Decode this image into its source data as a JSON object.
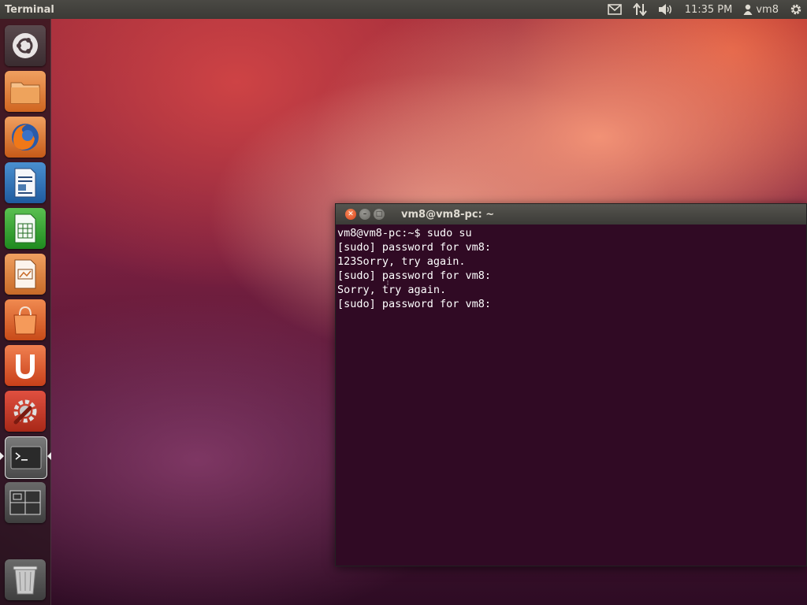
{
  "top_panel": {
    "app_title": "Terminal",
    "clock": "11:35 PM",
    "user": "vm8",
    "icons": [
      "mail-icon",
      "network-icon",
      "volume-icon",
      "user-icon",
      "gear-icon"
    ]
  },
  "launcher": {
    "items": [
      {
        "name": "dash-home",
        "icon": "ubuntu-logo-icon"
      },
      {
        "name": "home-folder",
        "icon": "folder-icon"
      },
      {
        "name": "firefox",
        "icon": "firefox-icon"
      },
      {
        "name": "libreoffice-writer",
        "icon": "writer-icon"
      },
      {
        "name": "libreoffice-calc",
        "icon": "calc-icon"
      },
      {
        "name": "libreoffice-impress",
        "icon": "impress-icon"
      },
      {
        "name": "software-center",
        "icon": "shopping-bag-icon"
      },
      {
        "name": "ubuntu-one",
        "icon": "ubuntu-one-icon"
      },
      {
        "name": "system-settings",
        "icon": "settings-wrench-icon"
      },
      {
        "name": "terminal",
        "icon": "terminal-icon",
        "active": true
      },
      {
        "name": "workspace-switcher",
        "icon": "workspaces-icon"
      },
      {
        "name": "trash",
        "icon": "trash-icon"
      }
    ]
  },
  "terminal": {
    "title": "vm8@vm8-pc: ~",
    "lines": [
      "vm8@vm8-pc:~$ sudo su",
      "[sudo] password for vm8:",
      "123Sorry, try again.",
      "[sudo] password for vm8:",
      "Sorry, try again.",
      "[sudo] password for vm8:"
    ]
  },
  "colors": {
    "terminal_bg": "#300a24",
    "panel_bg": "#3c3b37",
    "close_button": "#e05d2c"
  }
}
